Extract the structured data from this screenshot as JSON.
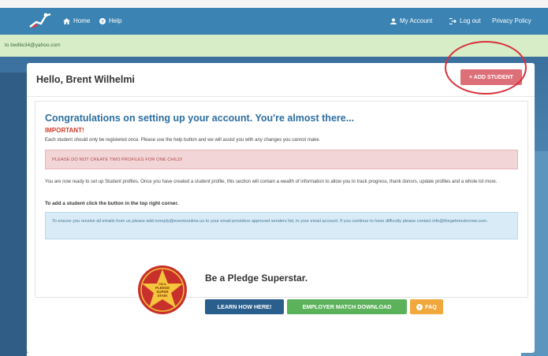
{
  "navbar": {
    "home_label": "Home",
    "help_label": "Help",
    "account_label": "My Account",
    "logout_label": "Log out",
    "privacy_label": "Privacy Policy"
  },
  "alert": {
    "text": "to bwillie34@yahoo.com"
  },
  "header": {
    "greeting": "Hello, Brent Wilhelmi",
    "add_student_label": "+ ADD STUDENT"
  },
  "welcome": {
    "title": "Congratulations on setting up your account. You're almost there...",
    "important_label": "IMPORTANT!",
    "register_once": "Each student should only be registered once. Please use the help button and we will assist you with any changes you cannot make.",
    "warning": "PLEASE DO NOT CREATE TWO PROFILES FOR ONE CHILD!",
    "setup_text": "You are now ready to set up Student profiles. Once you have created a student profile, this section will contain a wealth of information to allow you to track progress, thank donors, update profiles and a whole lot more.",
    "add_hint": "To add a student click the button in the top right corner.",
    "email_notice": "To ensure you receive all emails from us please add noreply@eventsonline.us to your email providers approved senders list, in your email account. If you continue to have difficulty please contact info@thegetmovincrew.com."
  },
  "pledge": {
    "title": "Be a Pledge Superstar.",
    "badge_line1": "I'M A",
    "badge_line2": "PLEDGE",
    "badge_line3": "SUPER",
    "badge_line4": "STAR!",
    "learn_label": "LEARN HOW HERE!",
    "employer_label": "EMPLOYER MATCH DOWNLOAD",
    "faq_label": "FAQ"
  },
  "colors": {
    "navbar": "#3b83b3",
    "alert_bg": "#d6edc8",
    "add_button": "#dd6f79",
    "title_blue": "#2d6fa0",
    "important_red": "#d33a2b",
    "learn_button": "#295e8d",
    "employer_button": "#5bb25a",
    "faq_button": "#f0a73c",
    "highlight_ring": "#d8303a"
  },
  "icons": {
    "logo": "runner-logo-icon",
    "home": "home-icon",
    "help": "help-circle-icon",
    "account": "user-icon",
    "logout": "logout-icon",
    "faq": "question-circle-icon",
    "badge": "star-badge-icon"
  }
}
